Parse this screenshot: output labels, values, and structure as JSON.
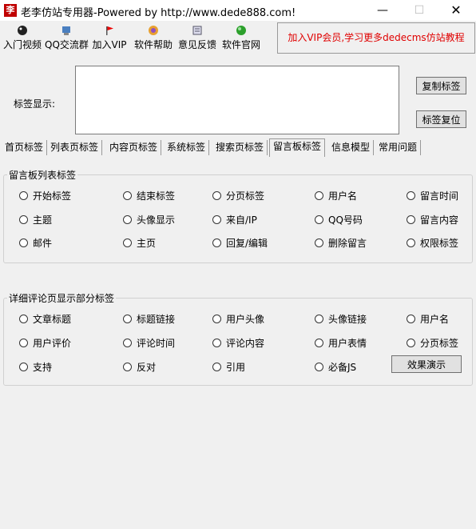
{
  "window": {
    "title": "老李仿站专用器-Powered by http://www.dede888.com!",
    "minimize": "—",
    "maximize": "☐",
    "close": "✕"
  },
  "toolbar": {
    "items": [
      {
        "label": "入门视频",
        "icon": "film-icon"
      },
      {
        "label": "QQ交流群",
        "icon": "group-icon"
      },
      {
        "label": "加入VIP",
        "icon": "flag-icon"
      },
      {
        "label": "软件帮助",
        "icon": "help-icon"
      },
      {
        "label": "意见反馈",
        "icon": "feedback-icon"
      },
      {
        "label": "软件官网",
        "icon": "globe-icon"
      }
    ],
    "banner": "加入VIP会员,学习更多dedecms仿站教程"
  },
  "tag_display": {
    "label": "标签显示:",
    "value": "",
    "copy_button": "复制标签",
    "reset_button": "标签复位"
  },
  "tabs": [
    {
      "label": "首页标签",
      "active": false
    },
    {
      "label": "列表页标签",
      "active": false
    },
    {
      "label": "内容页标签",
      "active": false
    },
    {
      "label": "系统标签",
      "active": false
    },
    {
      "label": "搜索页标签",
      "active": false
    },
    {
      "label": "留言板标签",
      "active": true
    },
    {
      "label": "信息模型",
      "active": false
    },
    {
      "label": "常用问题",
      "active": false
    }
  ],
  "group1": {
    "title": "留言板列表标签",
    "options": [
      "开始标签",
      "结束标签",
      "分页标签",
      "用户名",
      "留言时间",
      "主题",
      "头像显示",
      "来自/IP",
      "QQ号码",
      "留言内容",
      "邮件",
      "主页",
      "回复/编辑",
      "删除留言",
      "权限标签"
    ]
  },
  "group2": {
    "title": "详细评论页显示部分标签",
    "options": [
      "文章标题",
      "标题链接",
      "用户头像",
      "头像链接",
      "用户名",
      "用户评价",
      "评论时间",
      "评论内容",
      "用户表情",
      "分页标签",
      "支持",
      "反对",
      "引用",
      "必备JS"
    ],
    "demo_button": "效果演示"
  }
}
